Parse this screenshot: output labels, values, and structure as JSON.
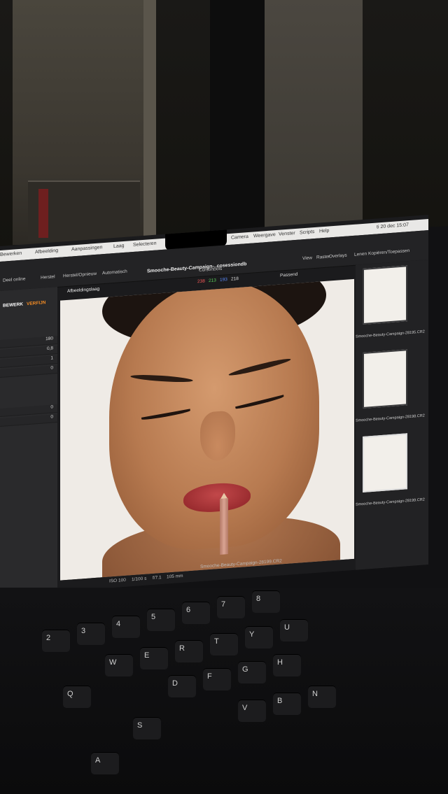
{
  "menubar": {
    "items": [
      "Bewerken",
      "Afbeelding",
      "Aanpassingen",
      "Laag",
      "Selecteren",
      "Camera",
      "Weergave",
      "Venster",
      "Scripts",
      "Help"
    ],
    "clock": "ti 20 dec  15:07"
  },
  "document": {
    "title": "Smooche-Beauty-Campaign-..cosessiondb"
  },
  "toolbar": {
    "share": "Deel online",
    "herstel": "Herstel",
    "herstel_opnieuw": "Herstel/Opnieuw",
    "automatisch": "Automatisch",
    "cursortools": "Cursortools",
    "view": "View",
    "raster": "Raster",
    "overlays": "Overlays",
    "lenen": "Lenen",
    "kopieren": "Kopiëren/Toepassen",
    "fit": "Passend",
    "rgb": [
      "238",
      "213",
      "193",
      "218"
    ],
    "rgb_colors": [
      "#ff5b5b",
      "#5bd35b",
      "#5b8bff",
      "#dddddd"
    ],
    "variant": "V1564"
  },
  "left_panel": {
    "tab_bewerk": "BEWERK",
    "tab_verfijn": "VERFIJN",
    "layer_label": "Afbeeldingslaag",
    "values": [
      "180",
      "0,8",
      "1",
      "0",
      "0",
      "0"
    ]
  },
  "thumbnails": [
    "Smooche-Beauty-Campaign-28195.CR2",
    "Smooche-Beauty-Campaign-28198.CR2",
    "Smooche-Beauty-Campaign-28199.CR2"
  ],
  "status": {
    "filename": "Smooche-Beauty-Campaign-28199.CR2",
    "iso": "ISO 100",
    "shutter": "1/100 s",
    "aperture": "f/7.1",
    "focal": "105 mm"
  }
}
